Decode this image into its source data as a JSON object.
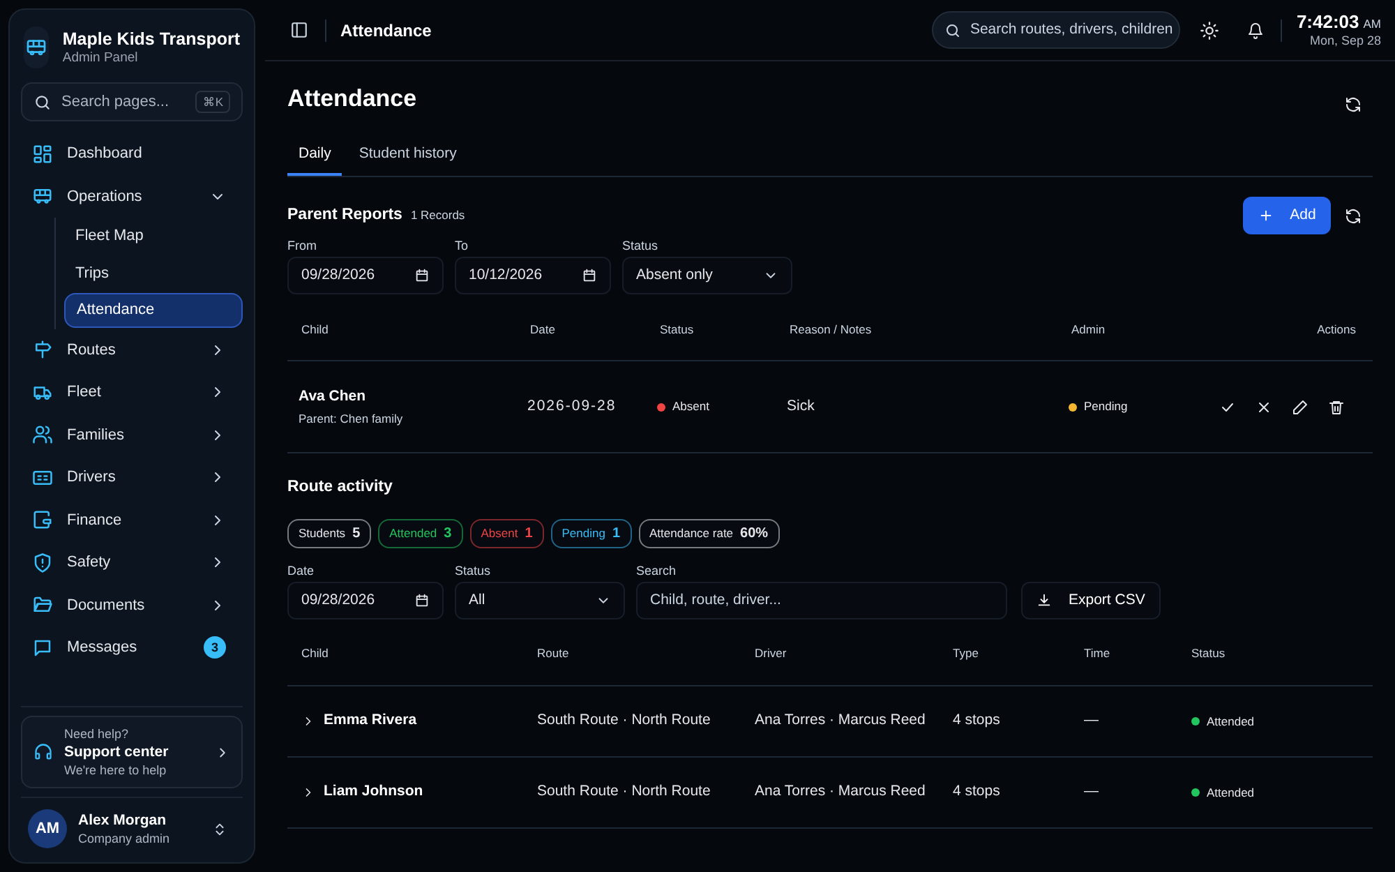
{
  "brand": {
    "title": "Maple Kids Transport",
    "subtitle": "Admin Panel"
  },
  "sidebar_search": {
    "placeholder": "Search pages...",
    "shortcut": "⌘K"
  },
  "nav": [
    {
      "label": "Dashboard",
      "selected": false
    },
    {
      "label": "Operations",
      "selected": false,
      "expanded": true,
      "children": [
        {
          "label": "Fleet Map",
          "selected": false
        },
        {
          "label": "Trips",
          "selected": false
        },
        {
          "label": "Attendance",
          "selected": true
        }
      ]
    },
    {
      "label": "Routes",
      "selected": false,
      "expanded": false
    },
    {
      "label": "Fleet",
      "selected": false,
      "expanded": false
    },
    {
      "label": "Families",
      "selected": false,
      "expanded": false
    },
    {
      "label": "Drivers",
      "selected": false,
      "expanded": false
    },
    {
      "label": "Finance",
      "selected": false,
      "expanded": false
    },
    {
      "label": "Safety",
      "selected": false,
      "expanded": false
    },
    {
      "label": "Documents",
      "selected": false,
      "expanded": false
    },
    {
      "label": "Messages",
      "selected": false,
      "badge": "3"
    }
  ],
  "support": {
    "kicker": "Need help?",
    "title": "Support center",
    "subtitle": "We're here to help"
  },
  "user": {
    "initials": "AM",
    "name": "Alex Morgan",
    "role": "Company admin"
  },
  "topbar": {
    "title": "Attendance",
    "search_placeholder": "Search routes, drivers, children",
    "time": "7:42:03",
    "ampm": "AM",
    "date": "Mon, Sep 28"
  },
  "page_title": "Attendance",
  "tabs": [
    {
      "label": "Daily",
      "selected": true
    },
    {
      "label": "Student history",
      "selected": false
    }
  ],
  "parent_reports": {
    "title": "Parent Reports",
    "count": "1 Records",
    "add_button": "Add",
    "filters": [
      {
        "kind": "date",
        "label": "From",
        "value": "09/28/2026"
      },
      {
        "kind": "date",
        "label": "To",
        "value": "10/12/2026"
      },
      {
        "kind": "select",
        "label": "Status",
        "value": "Absent only"
      }
    ],
    "columns": [
      "Child",
      "Date",
      "Status",
      "Reason / Notes",
      "Admin",
      "Actions"
    ],
    "rows": [
      {
        "child": "Ava Chen",
        "parent": "Parent: Chen family",
        "date": "2026-09-28",
        "status": {
          "label": "Absent",
          "color": "#ef4444"
        },
        "reason": "Sick",
        "admin": {
          "label": "Pending",
          "color": "#f5b731"
        }
      }
    ]
  },
  "route_activity": {
    "title": "Route activity",
    "stats": [
      {
        "label": "Students",
        "value": "5",
        "color": "#e5e7eb"
      },
      {
        "label": "Attended",
        "value": "3",
        "color": "#22c55e"
      },
      {
        "label": "Absent",
        "value": "1",
        "color": "#ef4444"
      },
      {
        "label": "Pending",
        "value": "1",
        "color": "#38bdf8"
      },
      {
        "label": "Attendance rate",
        "value": "60%",
        "color": "#e5e7eb"
      }
    ],
    "filters": [
      {
        "kind": "date",
        "label": "Date",
        "value": "09/28/2026"
      },
      {
        "kind": "select",
        "label": "Status",
        "value": "All"
      }
    ],
    "search": {
      "label": "Search",
      "placeholder": "Child, route, driver..."
    },
    "export_button": "Export CSV",
    "columns": [
      "Child",
      "Route",
      "Driver",
      "Type",
      "Time",
      "Status"
    ],
    "rows": [
      {
        "child": "Emma Rivera",
        "route": "South Route · North Route",
        "driver": "Ana Torres · Marcus Reed",
        "type": "4 stops",
        "time": "—",
        "status": {
          "label": "Attended",
          "color": "#22c55e"
        },
        "expanded": false
      },
      {
        "child": "Liam Johnson",
        "route": "South Route · North Route",
        "driver": "Ana Torres · Marcus Reed",
        "type": "4 stops",
        "time": "—",
        "status": {
          "label": "Attended",
          "color": "#22c55e"
        },
        "expanded": false
      }
    ]
  }
}
